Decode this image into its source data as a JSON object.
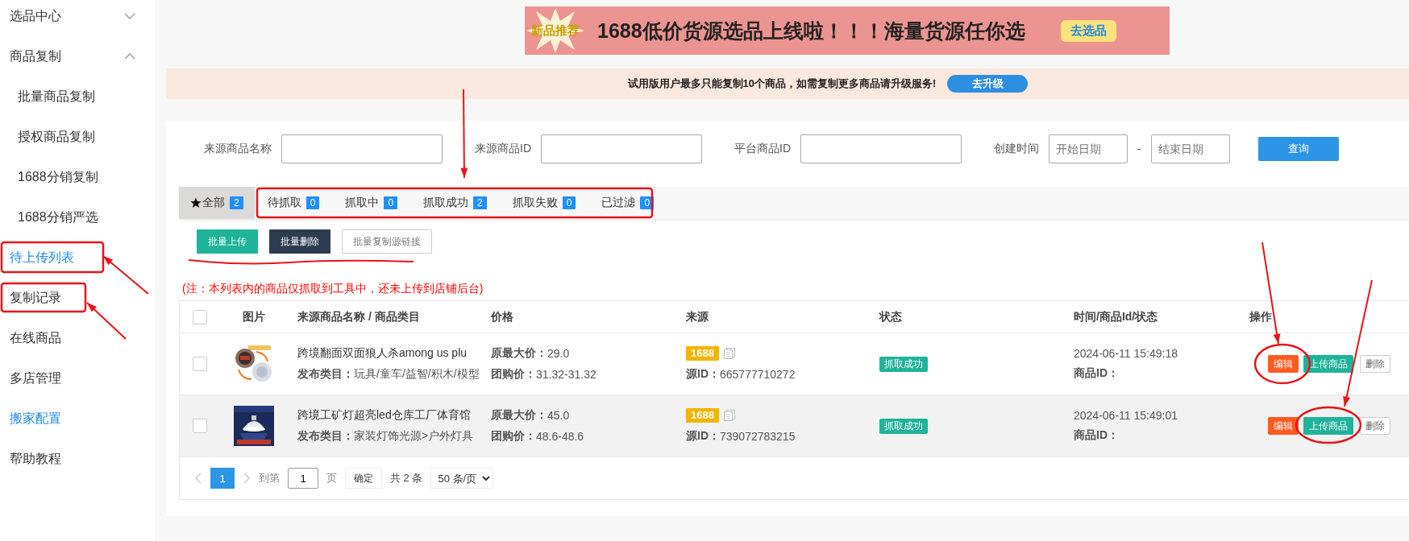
{
  "sidebar": {
    "items": [
      {
        "label": "选品中心",
        "expanded": false,
        "selected": false
      },
      {
        "label": "商品复制",
        "expanded": true,
        "selected": false,
        "children": [
          {
            "label": "批量商品复制",
            "selected": false
          },
          {
            "label": "授权商品复制",
            "selected": false
          },
          {
            "label": "1688分销复制",
            "selected": false
          },
          {
            "label": "1688分销严选",
            "selected": false
          }
        ]
      },
      {
        "label": "待上传列表",
        "selected": true
      },
      {
        "label": "复制记录",
        "selected": false
      },
      {
        "label": "在线商品",
        "selected": false
      },
      {
        "label": "多店管理",
        "selected": false
      },
      {
        "label": "搬家配置",
        "selected": true
      },
      {
        "label": "帮助教程",
        "selected": false
      }
    ]
  },
  "banner": {
    "badge": "新品推荐",
    "text": "1688低价货源选品上线啦！！！海量货源任你选",
    "button": "去选品"
  },
  "notice": {
    "text": "试用版用户最多只能复制10个商品，如需复制更多商品请升级服务!",
    "button": "去升级"
  },
  "filters": [
    {
      "kind": "text",
      "label": "来源商品名称"
    },
    {
      "kind": "text",
      "label": "来源商品ID"
    },
    {
      "kind": "text",
      "label": "平台商品ID"
    },
    {
      "kind": "date_range",
      "label": "创建时间",
      "start_placeholder": "开始日期",
      "separator": "-",
      "end_placeholder": "结束日期"
    }
  ],
  "search_button": "查询",
  "tabs": [
    {
      "label": "全部",
      "count": "2",
      "selected": true,
      "starred": true
    },
    {
      "label": "待抓取",
      "count": "0",
      "selected": false,
      "starred": false
    },
    {
      "label": "抓取中",
      "count": "0",
      "selected": false,
      "starred": false
    },
    {
      "label": "抓取成功",
      "count": "2",
      "selected": false,
      "starred": false
    },
    {
      "label": "抓取失败",
      "count": "0",
      "selected": false,
      "starred": false
    },
    {
      "label": "已过滤",
      "count": "0",
      "selected": false,
      "starred": false
    }
  ],
  "actions": [
    {
      "kind": "primary",
      "label": "批量上传"
    },
    {
      "kind": "dark",
      "label": "批量删除"
    },
    {
      "kind": "outline",
      "label": "批量复制源链接"
    }
  ],
  "note": "(注：本列表内的商品仅抓取到工具中，还未上传到店铺后台)",
  "table": {
    "select_all_checked": false,
    "columns": [
      "图片",
      "来源商品名称 / 商品类目",
      "价格",
      "来源",
      "状态",
      "时间/商品Id/状态",
      "操作"
    ],
    "rows": [
      {
        "checked": false,
        "hovered": false,
        "image": {
          "kind": "picture"
        },
        "name": "跨境翻面双面狼人杀among us plu",
        "category_label": "发布类目：",
        "category": "玩具/童车/益智/积木/模型",
        "max_price_label": "原最大价：",
        "max_price": "29.0",
        "group_price_label": "团购价：",
        "group_price": "31.32-31.32",
        "source": "1688",
        "source_id_label": "源ID：",
        "source_id": "665777710272",
        "status": "抓取成功",
        "time": "2024-06-11 15:49:18",
        "product_id_label": "商品ID：",
        "buttons": [
          "编辑",
          "上传商品",
          "删除"
        ]
      },
      {
        "checked": false,
        "hovered": true,
        "image": {
          "kind": "picture"
        },
        "name": "跨境工矿灯超亮led仓库工厂体育馆",
        "category_label": "发布类目：",
        "category": "家装灯饰光源>户外灯具",
        "max_price_label": "原最大价：",
        "max_price": "45.0",
        "group_price_label": "团购价：",
        "group_price": "48.6-48.6",
        "source": "1688",
        "source_id_label": "源ID：",
        "source_id": "739072783215",
        "status": "抓取成功",
        "time": "2024-06-11 15:49:01",
        "product_id_label": "商品ID：",
        "buttons": [
          "编辑",
          "上传商品",
          "删除"
        ]
      }
    ]
  },
  "pagination": {
    "pages": [
      {
        "label": "1",
        "selected": true
      }
    ],
    "goto_label": "到第",
    "goto_value": "1",
    "page_unit": "页",
    "confirm": "确定",
    "total": "共 2 条",
    "page_size": "50 条/页"
  }
}
